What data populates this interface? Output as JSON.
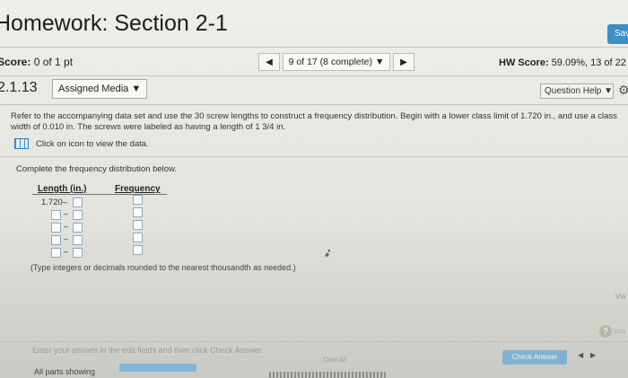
{
  "header": {
    "title": "Homework: Section 2-1",
    "save_label": "Sav"
  },
  "score_bar": {
    "score_label": "Score:",
    "score_value": "0 of 1 pt",
    "nav_prev": "◀",
    "nav_select": "9 of 17 (8 complete) ▼",
    "nav_next": "▶",
    "hw_score_label": "HW Score:",
    "hw_score_value": "59.09%, 13 of 22 p"
  },
  "question_bar": {
    "number": "2.1.13",
    "media_button": "Assigned Media ▼",
    "help_button": "Question Help ▼",
    "gear_glyph": "⚙"
  },
  "question": {
    "prompt": "Refer to the accompanying data set and use the 30 screw lengths to construct a frequency distribution. Begin with a lower class limit of 1.720 in., and use a class width of 0.010 in. The screws were labeled as having a length of 1 3/4 in.",
    "data_link": "Click on icon to view the data.",
    "instruction": "Complete the frequency distribution below.",
    "table": {
      "col_length": "Length (in.)",
      "col_frequency": "Frequency",
      "first_lower": "1.720",
      "rows": 5
    },
    "note": "(Type integers or decimals rounded to the nearest thousandth as needed.)"
  },
  "side": {
    "label1": "Vie",
    "help_glyph": "?",
    "label2": "Inco"
  },
  "footer": {
    "enter_text": "Enter your answer in the edit fields and then click Check Answer.",
    "check_button": "Check Answer",
    "clear_all": "Clear All",
    "parts_text": "All parts showing",
    "page_prev": "◀",
    "page_next": "▶"
  },
  "colors": {
    "accent": "#3b8fc6",
    "progress": "#7fb7da"
  }
}
